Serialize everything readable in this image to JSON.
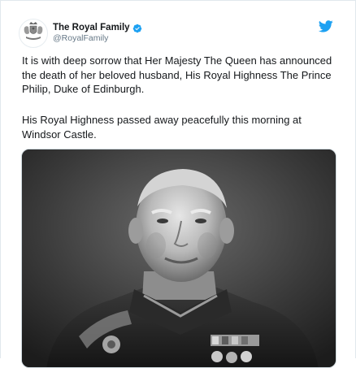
{
  "account": {
    "display_name": "The Royal Family",
    "handle": "@RoyalFamily",
    "avatar_icon": "royal-crest-icon",
    "verified_icon": "verified-badge-icon",
    "platform_icon": "twitter-bird-icon"
  },
  "tweet": {
    "paragraph_1": "It is with deep sorrow that Her Majesty The Queen has announced the death of her beloved husband, His Royal Highness The Prince Philip, Duke of Edinburgh.",
    "paragraph_2": "His Royal Highness passed away peacefully this morning at Windsor Castle."
  },
  "colors": {
    "twitter_blue": "#1da1f2",
    "text": "#14171a",
    "secondary_text": "#657786"
  }
}
